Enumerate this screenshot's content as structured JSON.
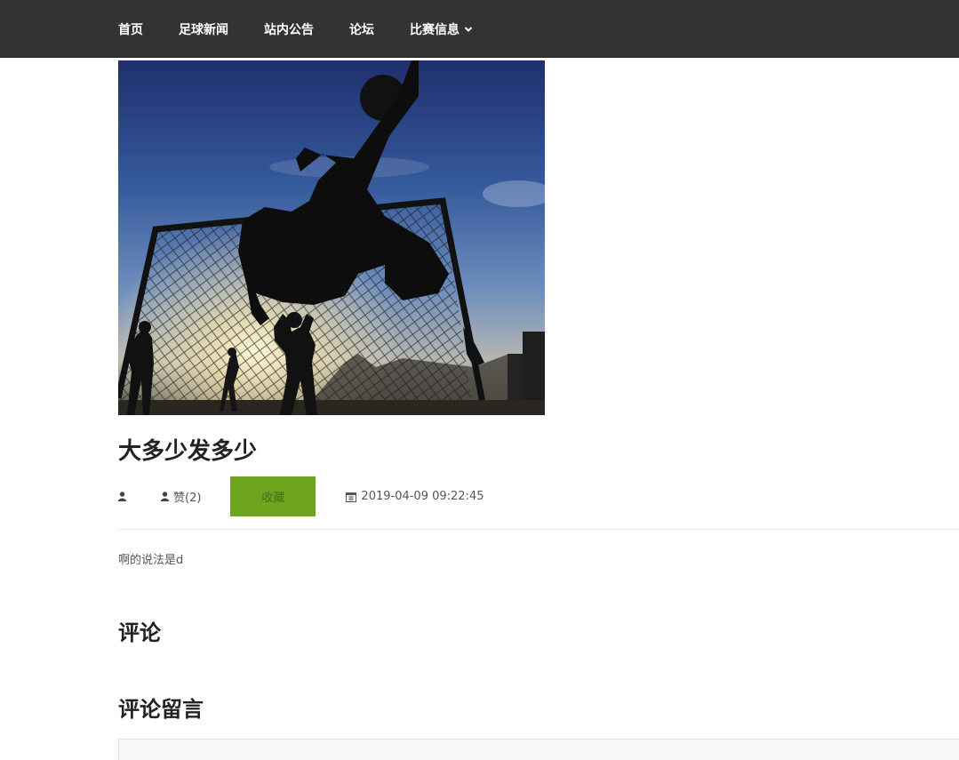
{
  "nav": {
    "items": [
      {
        "label": "首页"
      },
      {
        "label": "足球新闻"
      },
      {
        "label": "站内公告"
      },
      {
        "label": "论坛"
      },
      {
        "label": "比赛信息"
      }
    ]
  },
  "article": {
    "title": "大多少发多少",
    "like_label": "赞(2)",
    "favorite_label": "收藏",
    "date": "2019-04-09 09:22:45",
    "body": "啊的说法是d"
  },
  "comments": {
    "heading": "评论",
    "leave_heading": "评论留言",
    "placeholder": ""
  },
  "colors": {
    "navbar": "#333333",
    "favorite_button": "#6ea41e"
  }
}
